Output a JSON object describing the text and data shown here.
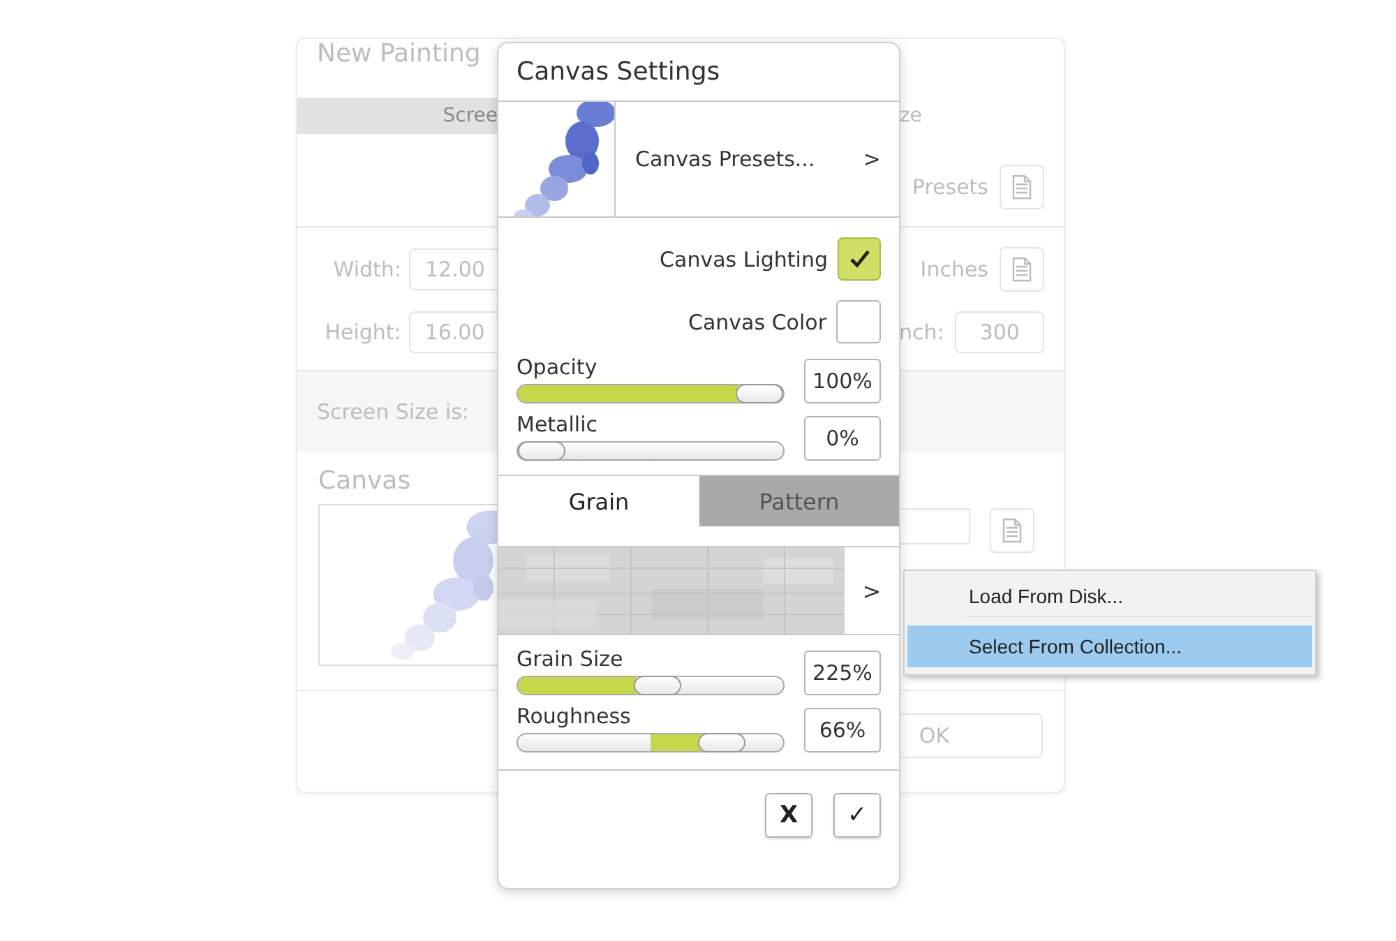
{
  "background_dialog": {
    "title": "New Painting",
    "tabs": [
      {
        "label": "Scree",
        "selected": true
      },
      {
        "label": "ze",
        "selected": false
      }
    ],
    "presets_label": "Presets",
    "width": {
      "label": "Width:",
      "value": "12.00"
    },
    "units": "Inches",
    "height": {
      "label": "Height:",
      "value": "16.00"
    },
    "resolution": {
      "label": "nch:",
      "value": "300"
    },
    "screen_size_label": "Screen Size is:",
    "canvas_label": "Canvas",
    "ok_button": "OK"
  },
  "canvas_settings": {
    "title": "Canvas Settings",
    "presets_button": "Canvas Presets...",
    "presets_arrow": ">",
    "toggles": [
      {
        "kind": "checkbox",
        "label": "Canvas Lighting",
        "checked": true
      },
      {
        "kind": "swatch",
        "label": "Canvas Color",
        "color": "#ffffff"
      }
    ],
    "sliders": [
      {
        "label": "Opacity",
        "kind": "from_start",
        "level": 1,
        "reading": "100%"
      },
      {
        "label": "Metallic",
        "kind": "from_start",
        "level": 0,
        "reading": "0%"
      }
    ],
    "tabs": [
      {
        "label": "Grain",
        "selected": true
      },
      {
        "label": "Pattern",
        "selected": false
      }
    ],
    "texture_arrow": ">",
    "grain_sliders": [
      {
        "label": "Grain Size",
        "kind": "from_start",
        "level": 0.53,
        "reading": "225%"
      },
      {
        "label": "Roughness",
        "kind": "from_center",
        "level": 0.83,
        "reading": "66%"
      }
    ],
    "buttons": [
      {
        "label": "X"
      },
      {
        "label": "✓"
      }
    ]
  },
  "context_menu": {
    "items": [
      {
        "label": "Load From Disk...",
        "selected": false
      },
      {
        "label": "Select From Collection...",
        "selected": true
      }
    ]
  }
}
